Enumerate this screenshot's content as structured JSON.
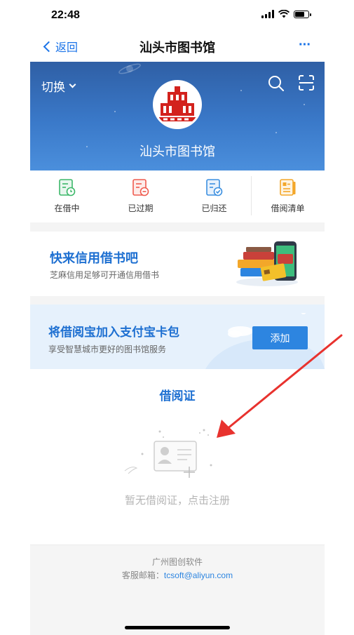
{
  "status_bar": {
    "time": "22:48"
  },
  "nav": {
    "back_label": "返回",
    "title": "汕头市图书馆",
    "more_label": "···"
  },
  "banner": {
    "switch_label": "切换",
    "library_name": "汕头市图书馆"
  },
  "tabs": [
    {
      "label": "在借中",
      "icon": "clock-doc-icon",
      "color": "#3db86a"
    },
    {
      "label": "已过期",
      "icon": "minus-doc-icon",
      "color": "#ef5b4f"
    },
    {
      "label": "已归还",
      "icon": "check-doc-icon",
      "color": "#3b8fe0"
    },
    {
      "label": "借阅清单",
      "icon": "list-doc-icon",
      "color": "#f3a72a"
    }
  ],
  "credit_card": {
    "title": "快来信用借书吧",
    "subtitle": "芝麻信用足够可开通信用借书"
  },
  "alipay_card": {
    "title": "将借阅宝加入支付宝卡包",
    "subtitle": "享受智慧城市更好的图书馆服务",
    "button_label": "添加"
  },
  "library_card": {
    "title": "借阅证",
    "empty_text": "暂无借阅证，点击注册"
  },
  "footer": {
    "company": "广州图创软件",
    "email_label": "客服邮箱：",
    "email": "tcsoft@aliyun.com"
  },
  "colors": {
    "accent": "#1d6fd1",
    "button": "#2d85e0",
    "banner": "#3a79c9",
    "arrow": "#e8322e"
  }
}
